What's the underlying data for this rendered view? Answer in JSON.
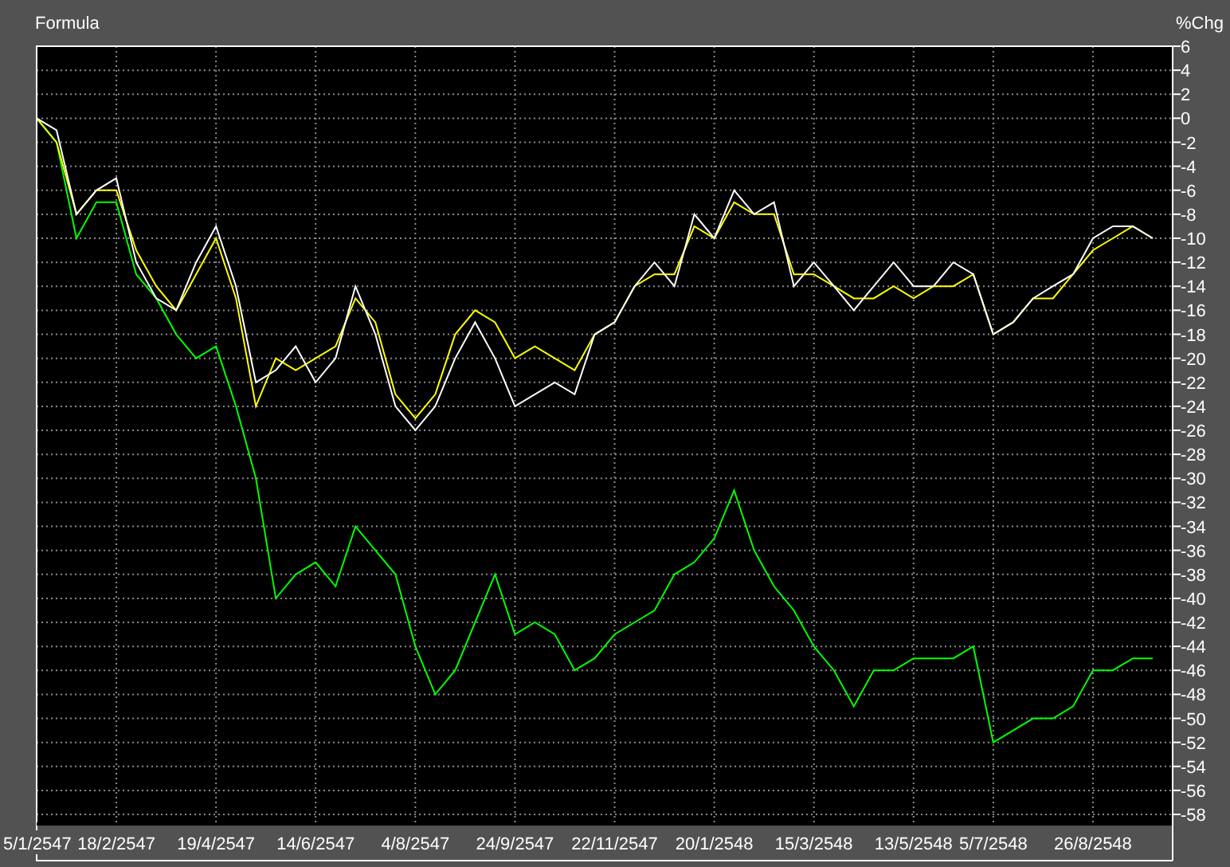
{
  "chart_data": {
    "type": "line",
    "title": "Formula",
    "ylabel": "%Chg",
    "categories": [
      "5/1/2547",
      null,
      null,
      null,
      "18/2/2547",
      null,
      null,
      null,
      null,
      "19/4/2547",
      null,
      null,
      null,
      null,
      "14/6/2547",
      null,
      null,
      null,
      null,
      "4/8/2547",
      null,
      null,
      null,
      null,
      "24/9/2547",
      null,
      null,
      null,
      null,
      "22/11/2547",
      null,
      null,
      null,
      null,
      "20/1/2548",
      null,
      null,
      null,
      null,
      "15/3/2548",
      null,
      null,
      null,
      null,
      "13/5/2548",
      null,
      null,
      null,
      "5/7/2548",
      null,
      null,
      null,
      null,
      "26/8/2548",
      null,
      null,
      null
    ],
    "ylim": [
      -58,
      6
    ],
    "grid": true,
    "yticks": [
      6,
      4,
      2,
      0,
      -2,
      -4,
      -6,
      -8,
      -10,
      -12,
      -14,
      -16,
      -18,
      -20,
      -22,
      -24,
      -26,
      -28,
      -30,
      -32,
      -34,
      -36,
      -38,
      -40,
      -42,
      -44,
      -46,
      -48,
      -50,
      -52,
      -54,
      -56,
      -58
    ],
    "series": [
      {
        "color": "#00ff00",
        "values": [
          0,
          -2,
          -10,
          -7,
          -7,
          -13,
          -15,
          -18,
          -20,
          -19,
          -24,
          -30,
          -40,
          -38,
          -37,
          -39,
          -34,
          -36,
          -38,
          -44,
          -48,
          -46,
          -42,
          -38,
          -43,
          -42,
          -43,
          -46,
          -45,
          -43,
          -42,
          -41,
          -38,
          -37,
          -35,
          -31,
          -36,
          -39,
          -41,
          -44,
          -46,
          -49,
          -46,
          -46,
          -45,
          -45,
          -45,
          -44,
          -52,
          -51,
          -50,
          -50,
          -49,
          -46,
          -46,
          -45,
          -45
        ]
      },
      {
        "color": "#ffff00",
        "values": [
          0,
          -2,
          -8,
          -6,
          -6,
          -11,
          -14,
          -16,
          -13,
          -10,
          -15,
          -24,
          -20,
          -21,
          -20,
          -19,
          -15,
          -17,
          -23,
          -25,
          -23,
          -18,
          -16,
          -17,
          -20,
          -19,
          -20,
          -21,
          -18,
          -17,
          -14,
          -13,
          -13,
          -9,
          -10,
          -7,
          -8,
          -8,
          -13,
          -13,
          -14,
          -15,
          -15,
          -14,
          -15,
          -14,
          -14,
          -13,
          -18,
          -17,
          -15,
          -15,
          -13,
          -11,
          -10,
          -9,
          -10
        ]
      },
      {
        "color": "#ffffff",
        "values": [
          0,
          -1,
          -8,
          -6,
          -5,
          -12,
          -15,
          -16,
          -12,
          -9,
          -14,
          -22,
          -21,
          -19,
          -22,
          -20,
          -14,
          -18,
          -24,
          -26,
          -24,
          -20,
          -17,
          -20,
          -24,
          -23,
          -22,
          -23,
          -18,
          -17,
          -14,
          -12,
          -14,
          -8,
          -10,
          -6,
          -8,
          -7,
          -14,
          -12,
          -14,
          -16,
          -14,
          -12,
          -14,
          -14,
          -12,
          -13,
          -18,
          -17,
          -15,
          -14,
          -13,
          -10,
          -9,
          -9,
          -10
        ]
      }
    ]
  }
}
